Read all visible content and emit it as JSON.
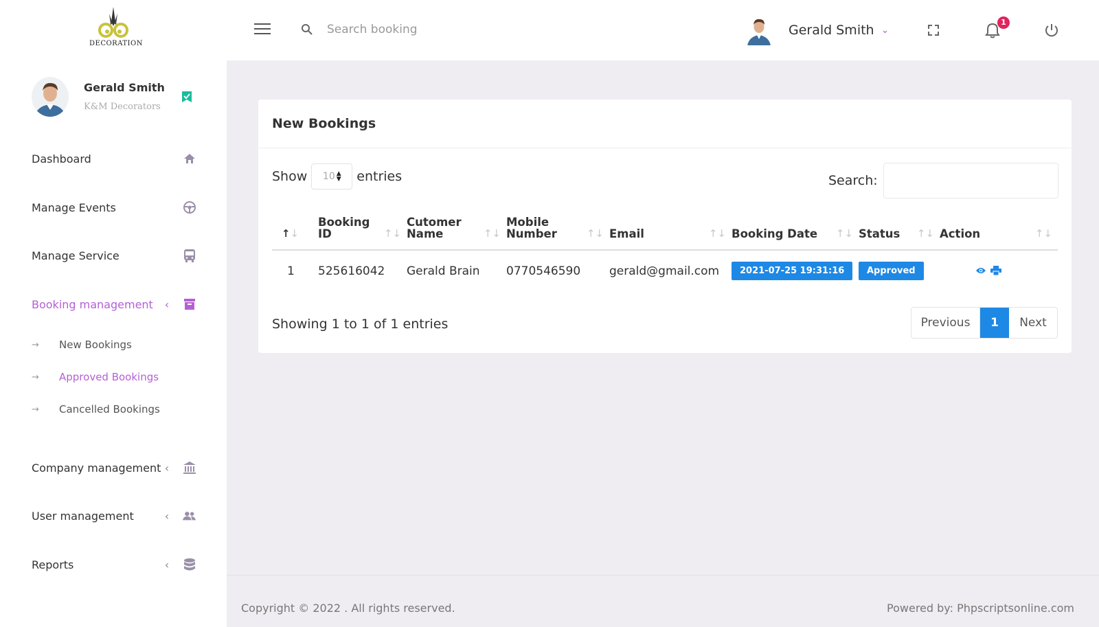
{
  "logo": {
    "text": "DECORATION",
    "accent": "#c9c23a"
  },
  "profile": {
    "name": "Gerald Smith",
    "company": "K&M Decorators"
  },
  "nav": {
    "dashboard": "Dashboard",
    "manage_events": "Manage Events",
    "manage_service": "Manage Service",
    "booking_management": "Booking management",
    "company_management": "Company management",
    "user_management": "User management",
    "reports": "Reports"
  },
  "subnav": {
    "new_bookings": "New Bookings",
    "approved_bookings": "Approved Bookings",
    "cancelled_bookings": "Cancelled Bookings"
  },
  "topbar": {
    "search_placeholder": "Search booking",
    "user_name": "Gerald Smith",
    "notification_count": "1"
  },
  "card": {
    "title": "New Bookings",
    "show_label": "Show",
    "entries_label": "entries",
    "page_size": "10",
    "search_label": "Search:",
    "columns": [
      "",
      "Booking ID",
      "Cutomer Name",
      "Mobile Number",
      "Email",
      "Booking Date",
      "Status",
      "Action"
    ],
    "rows": [
      {
        "index": "1",
        "booking_id": "525616042",
        "customer": "Gerald Brain",
        "mobile": "0770546590",
        "email": "gerald@gmail.com",
        "date": "2021-07-25 19:31:16",
        "status": "Approved"
      }
    ],
    "info": "Showing 1 to 1 of 1 entries",
    "pager": {
      "previous": "Previous",
      "current": "1",
      "next": "Next"
    }
  },
  "footer": {
    "copyright": "Copyright © 2022 . All rights reserved.",
    "powered": "Powered by: Phpscriptsonline.com"
  },
  "colors": {
    "accent": "#b55fd6",
    "primary": "#1e88e5",
    "badge": "#e0245e",
    "verified": "#1abc9c"
  }
}
